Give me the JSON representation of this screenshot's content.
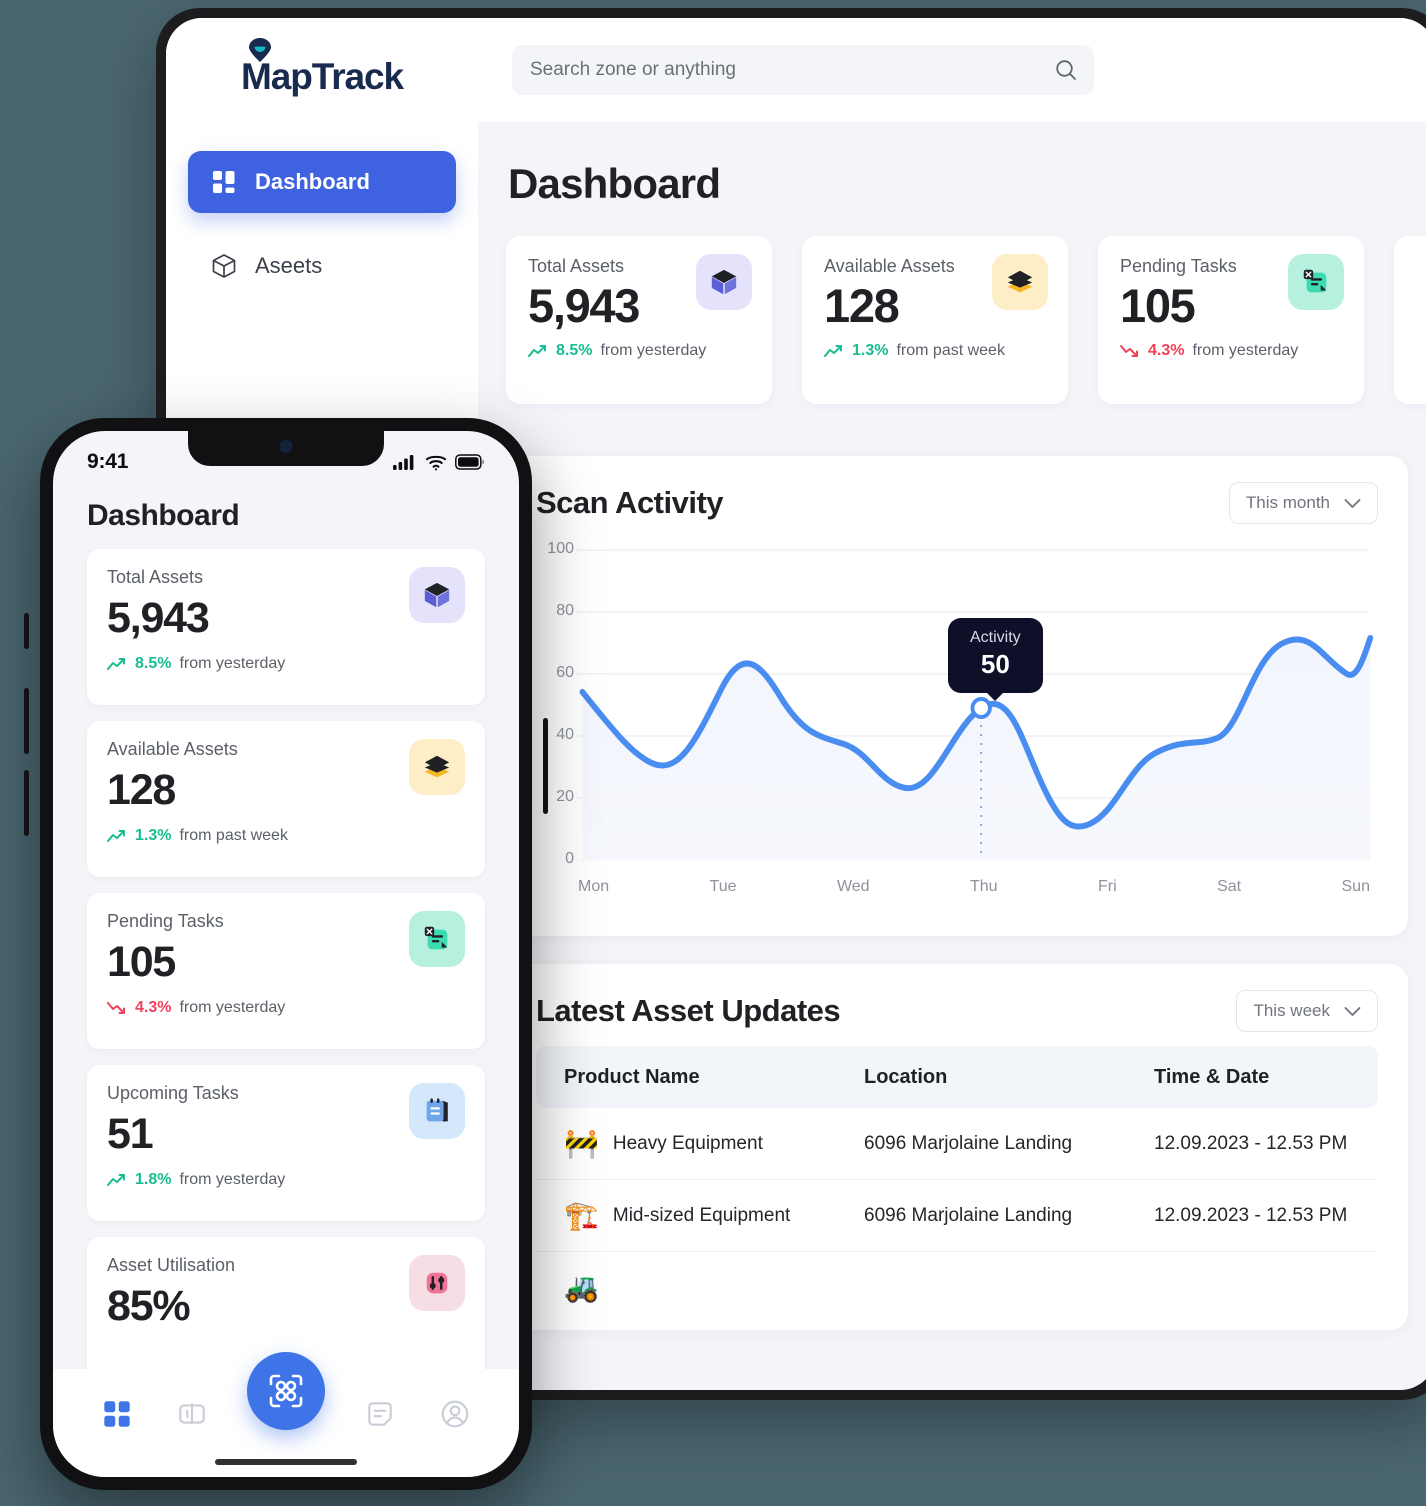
{
  "brand": {
    "name": "MapTrack",
    "accent": "#3f62e0",
    "navy": "#182a4e",
    "teal": "#17b8c4"
  },
  "desktop": {
    "search": {
      "placeholder": "Search zone or anything",
      "value": ""
    },
    "sidebar": {
      "items": [
        {
          "label": "Dashboard",
          "icon": "grid-icon",
          "active": true
        },
        {
          "label": "Aseets",
          "icon": "cube-outline-icon",
          "active": false
        }
      ]
    },
    "page_title": "Dashboard",
    "stats": [
      {
        "label": "Total Assets",
        "value": "5,943",
        "pct": "8.5%",
        "suffix": "from yesterday",
        "dir": "up",
        "icon": "cube-icon",
        "icon_bg": "#e4e3fb",
        "color": "#19bd93"
      },
      {
        "label": "Available Assets",
        "value": "128",
        "pct": "1.3%",
        "suffix": "from past week",
        "dir": "up",
        "icon": "layers-icon",
        "icon_bg": "#fdeec8",
        "color": "#19bd93"
      },
      {
        "label": "Pending Tasks",
        "value": "105",
        "pct": "4.3%",
        "suffix": "from yesterday",
        "dir": "down",
        "icon": "task-x-icon",
        "icon_bg": "#b8f0e0",
        "color": "#f2415a"
      }
    ],
    "scan_panel": {
      "title": "Scan Activity",
      "filter": "This month",
      "filter_icon": "chevron-down-icon"
    },
    "updates_panel": {
      "title": "Latest Asset Updates",
      "filter": "This week",
      "filter_icon": "chevron-down-icon",
      "columns": [
        "Product Name",
        "Location",
        "Time & Date"
      ],
      "rows": [
        {
          "emoji": "🚧",
          "product": "Heavy Equipment",
          "location": "6096 Marjolaine Landing",
          "time": "12.09.2023 - 12.53 PM"
        },
        {
          "emoji": "🏗️",
          "product": "Mid-sized Equipment",
          "location": "6096 Marjolaine Landing",
          "time": "12.09.2023 - 12.53 PM"
        },
        {
          "emoji": "🚜",
          "product": "",
          "location": "",
          "time": ""
        }
      ]
    }
  },
  "phone": {
    "status": {
      "time": "9:41",
      "signal_icon": "cellular-icon",
      "wifi_icon": "wifi-icon",
      "battery_icon": "battery-icon"
    },
    "title": "Dashboard",
    "cards": [
      {
        "label": "Total Assets",
        "value": "5,943",
        "pct": "8.5%",
        "suffix": "from yesterday",
        "dir": "up",
        "icon": "cube-icon",
        "icon_bg": "#e4e3fb"
      },
      {
        "label": "Available Assets",
        "value": "128",
        "pct": "1.3%",
        "suffix": "from past week",
        "dir": "up",
        "icon": "layers-icon",
        "icon_bg": "#fdeec8"
      },
      {
        "label": "Pending Tasks",
        "value": "105",
        "pct": "4.3%",
        "suffix": "from yesterday",
        "dir": "down",
        "icon": "task-x-icon",
        "icon_bg": "#b8f0e0"
      },
      {
        "label": "Upcoming Tasks",
        "value": "51",
        "pct": "1.8%",
        "suffix": "from yesterday",
        "dir": "up",
        "icon": "notepad-icon",
        "icon_bg": "#d5e7fb"
      },
      {
        "label": "Asset Utilisation",
        "value": "85%",
        "pct": "",
        "suffix": "",
        "dir": "up",
        "icon": "sliders-icon",
        "icon_bg": "#f7dde4"
      }
    ],
    "tabs": [
      {
        "name": "dashboard",
        "icon": "grid-icon",
        "active": true
      },
      {
        "name": "assets",
        "icon": "box-icon",
        "active": false
      },
      {
        "name": "scan",
        "icon": "scan-icon",
        "active": false,
        "fab": true
      },
      {
        "name": "tasks",
        "icon": "notes-icon",
        "active": false
      },
      {
        "name": "profile",
        "icon": "person-icon",
        "active": false
      }
    ]
  },
  "chart_data": {
    "type": "line",
    "title": "Scan Activity",
    "xlabel": "",
    "ylabel": "",
    "categories": [
      "Mon",
      "Tue",
      "Wed",
      "Thu",
      "Fri",
      "Sat",
      "Sun"
    ],
    "series": [
      {
        "name": "Activity",
        "values": [
          54,
          57,
          35,
          50,
          35,
          67,
          73
        ]
      }
    ],
    "detail_points": [
      54,
      31,
      57,
      36,
      34,
      23,
      50,
      13,
      33,
      35,
      67,
      57,
      73
    ],
    "yticks": [
      0,
      20,
      40,
      60,
      80,
      100
    ],
    "ylim": [
      0,
      100
    ],
    "grid": true,
    "line_color": "#4a8df0",
    "fill_color": "#f4f6fc",
    "legend": "none",
    "tooltip": {
      "label": "Activity",
      "value": "50",
      "at_category": "Thu"
    }
  }
}
